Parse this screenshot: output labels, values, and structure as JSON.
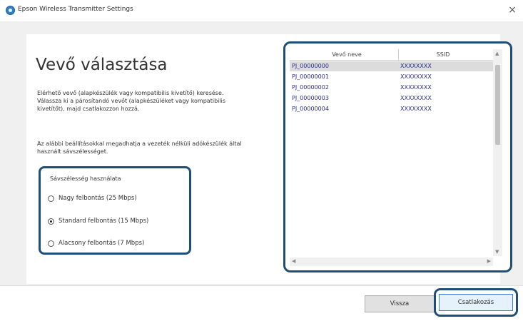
{
  "window": {
    "title": "Epson Wireless Transmitter Settings",
    "close_glyph": "×"
  },
  "main": {
    "heading": "Vevő választása",
    "description_1": "Elérhető vevő (alapkészülék vagy kompatibilis kivetítő) keresése. Válassza ki a párosítandó vevőt (alapkészüléket vagy kompatibilis kivetítőt), majd csatlakozzon hozzá.",
    "description_2": "Az alábbi beállításokkal megadhatja a vezeték nélküli adókészülék által használt sávszélességet."
  },
  "bandwidth": {
    "legend": "Sávszélesség használata",
    "options": [
      {
        "label": "Nagy felbontás (25 Mbps)",
        "checked": false
      },
      {
        "label": "Standard felbontás (15 Mbps)",
        "checked": true
      },
      {
        "label": "Alacsony felbontás (7 Mbps)",
        "checked": false
      }
    ]
  },
  "receiver_list": {
    "columns": [
      "Vevő neve",
      "SSID"
    ],
    "rows": [
      {
        "name": "PJ_00000000",
        "ssid": "XXXXXXXX",
        "selected": true
      },
      {
        "name": "PJ_00000001",
        "ssid": "XXXXXXXX",
        "selected": false
      },
      {
        "name": "PJ_00000002",
        "ssid": "XXXXXXXX",
        "selected": false
      },
      {
        "name": "PJ_00000003",
        "ssid": "XXXXXXXX",
        "selected": false
      },
      {
        "name": "PJ_00000004",
        "ssid": "XXXXXXXX",
        "selected": false
      }
    ]
  },
  "footer": {
    "back_label": "Vissza",
    "connect_label": "Csatlakozás"
  },
  "colors": {
    "highlight_border": "#1f4e79",
    "list_text": "#2b2e8a",
    "selected_row": "#dcdcdc"
  }
}
